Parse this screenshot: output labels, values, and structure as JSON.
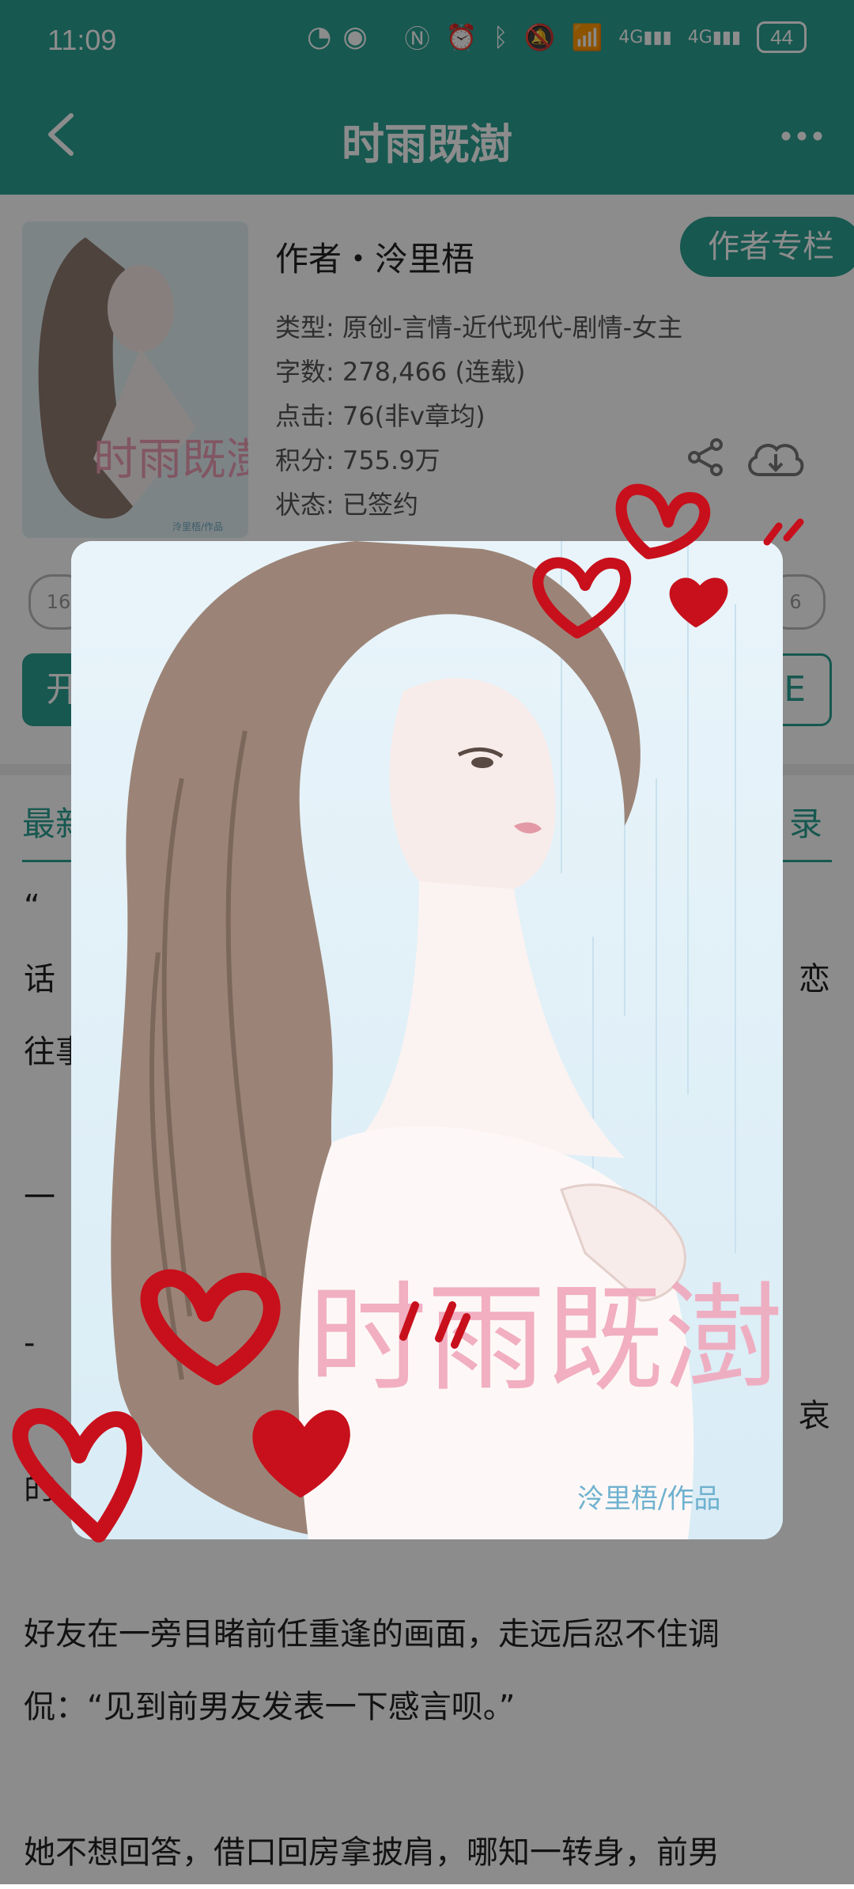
{
  "status_bar": {
    "time": "11:09",
    "center_icons": [
      "speed-icon",
      "eye-icon"
    ],
    "right_icons": [
      "nfc-icon",
      "alarm-icon",
      "bluetooth-icon",
      "mute-icon",
      "wifi-icon",
      "signal-4g-icon",
      "signal-4g-icon"
    ],
    "signal_label_1": "4G",
    "signal_label_2": "4G",
    "battery": "44"
  },
  "header": {
    "title": "时雨既澍",
    "back_icon": "chevron-left-icon",
    "more_icon": "more-horizontal-icon"
  },
  "book": {
    "author": "作者・泠里梧",
    "author_column_label": "作者专栏",
    "type": "类型: 原创-言情-近代现代-剧情-女主",
    "words": "字数: 278,466 (连载)",
    "clicks": "点击: 76(非v章均)",
    "score": "积分: 755.9万",
    "status": "状态: 已签约",
    "cover_small_caption": "泠里梧/作品",
    "left_badge": "16",
    "right_badge": "6",
    "start_button_partial": "开",
    "right_button_partial": "E"
  },
  "tabs": {
    "left_partial": "最新",
    "right_partial": "录"
  },
  "article": {
    "line1": "“",
    "line2_left": "话",
    "line2_right": "恋",
    "line3": "往事",
    "line4": "一",
    "line5": "-",
    "line6_right": "哀",
    "line7": "的",
    "paragraph2_line1": "好友在一旁目睹前任重逢的画面，走远后忍不住调",
    "paragraph2_line2": "侃：“见到前男友发表一下感言呗。”",
    "paragraph3_line1": "她不想回答，借口回房拿披肩，哪知一转身，前男"
  },
  "popup": {
    "cover_title_art": "时雨既澍",
    "cover_caption": "泠里梧/作品"
  },
  "colors": {
    "brand": "#2aa093",
    "overlay": "rgba(0,0,0,0.45)",
    "heart": "#c8101c"
  }
}
